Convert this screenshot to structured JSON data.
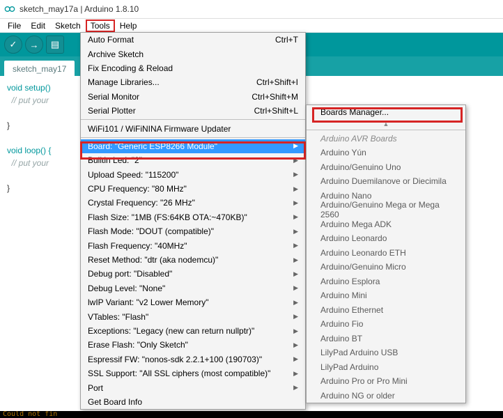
{
  "window": {
    "title": "sketch_may17a | Arduino 1.8.10"
  },
  "menubar": [
    "File",
    "Edit",
    "Sketch",
    "Tools",
    "Help"
  ],
  "tab": "sketch_may17",
  "code": {
    "setup_sig": "void setup()",
    "setup_comment": "  // put your",
    "loop_sig": "void loop() {",
    "loop_comment": "  // put your",
    "brace": "}"
  },
  "tools_menu": [
    {
      "label": "Auto Format",
      "shortcut": "Ctrl+T",
      "sub": false
    },
    {
      "label": "Archive Sketch",
      "shortcut": "",
      "sub": false
    },
    {
      "label": "Fix Encoding & Reload",
      "shortcut": "",
      "sub": false
    },
    {
      "label": "Manage Libraries...",
      "shortcut": "Ctrl+Shift+I",
      "sub": false
    },
    {
      "label": "Serial Monitor",
      "shortcut": "Ctrl+Shift+M",
      "sub": false
    },
    {
      "label": "Serial Plotter",
      "shortcut": "Ctrl+Shift+L",
      "sub": false
    },
    {
      "label": "_SEP"
    },
    {
      "label": "WiFi101 / WiFiNINA Firmware Updater",
      "shortcut": "",
      "sub": false
    },
    {
      "label": "_SEP"
    },
    {
      "label": "Board: \"Generic ESP8266 Module\"",
      "shortcut": "",
      "sub": true,
      "selected": true
    },
    {
      "label": "Builtin Led: \"2\"",
      "shortcut": "",
      "sub": true
    },
    {
      "label": "Upload Speed: \"115200\"",
      "shortcut": "",
      "sub": true
    },
    {
      "label": "CPU Frequency: \"80 MHz\"",
      "shortcut": "",
      "sub": true
    },
    {
      "label": "Crystal Frequency: \"26 MHz\"",
      "shortcut": "",
      "sub": true
    },
    {
      "label": "Flash Size: \"1MB (FS:64KB OTA:~470KB)\"",
      "shortcut": "",
      "sub": true
    },
    {
      "label": "Flash Mode: \"DOUT (compatible)\"",
      "shortcut": "",
      "sub": true
    },
    {
      "label": "Flash Frequency: \"40MHz\"",
      "shortcut": "",
      "sub": true
    },
    {
      "label": "Reset Method: \"dtr (aka nodemcu)\"",
      "shortcut": "",
      "sub": true
    },
    {
      "label": "Debug port: \"Disabled\"",
      "shortcut": "",
      "sub": true
    },
    {
      "label": "Debug Level: \"None\"",
      "shortcut": "",
      "sub": true
    },
    {
      "label": "lwIP Variant: \"v2 Lower Memory\"",
      "shortcut": "",
      "sub": true
    },
    {
      "label": "VTables: \"Flash\"",
      "shortcut": "",
      "sub": true
    },
    {
      "label": "Exceptions: \"Legacy (new can return nullptr)\"",
      "shortcut": "",
      "sub": true
    },
    {
      "label": "Erase Flash: \"Only Sketch\"",
      "shortcut": "",
      "sub": true
    },
    {
      "label": "Espressif FW: \"nonos-sdk 2.2.1+100 (190703)\"",
      "shortcut": "",
      "sub": true
    },
    {
      "label": "SSL Support: \"All SSL ciphers (most compatible)\"",
      "shortcut": "",
      "sub": true
    },
    {
      "label": "Port",
      "shortcut": "",
      "sub": true
    },
    {
      "label": "Get Board Info",
      "shortcut": "",
      "sub": false
    }
  ],
  "boards_submenu": {
    "top": "Boards Manager...",
    "header": "Arduino AVR Boards",
    "items": [
      "Arduino Yún",
      "Arduino/Genuino Uno",
      "Arduino Duemilanove or Diecimila",
      "Arduino Nano",
      "Arduino/Genuino Mega or Mega 2560",
      "Arduino Mega ADK",
      "Arduino Leonardo",
      "Arduino Leonardo ETH",
      "Arduino/Genuino Micro",
      "Arduino Esplora",
      "Arduino Mini",
      "Arduino Ethernet",
      "Arduino Fio",
      "Arduino BT",
      "LilyPad Arduino USB",
      "LilyPad Arduino",
      "Arduino Pro or Pro Mini",
      "Arduino NG or older"
    ]
  },
  "status_text": "Could not fin"
}
